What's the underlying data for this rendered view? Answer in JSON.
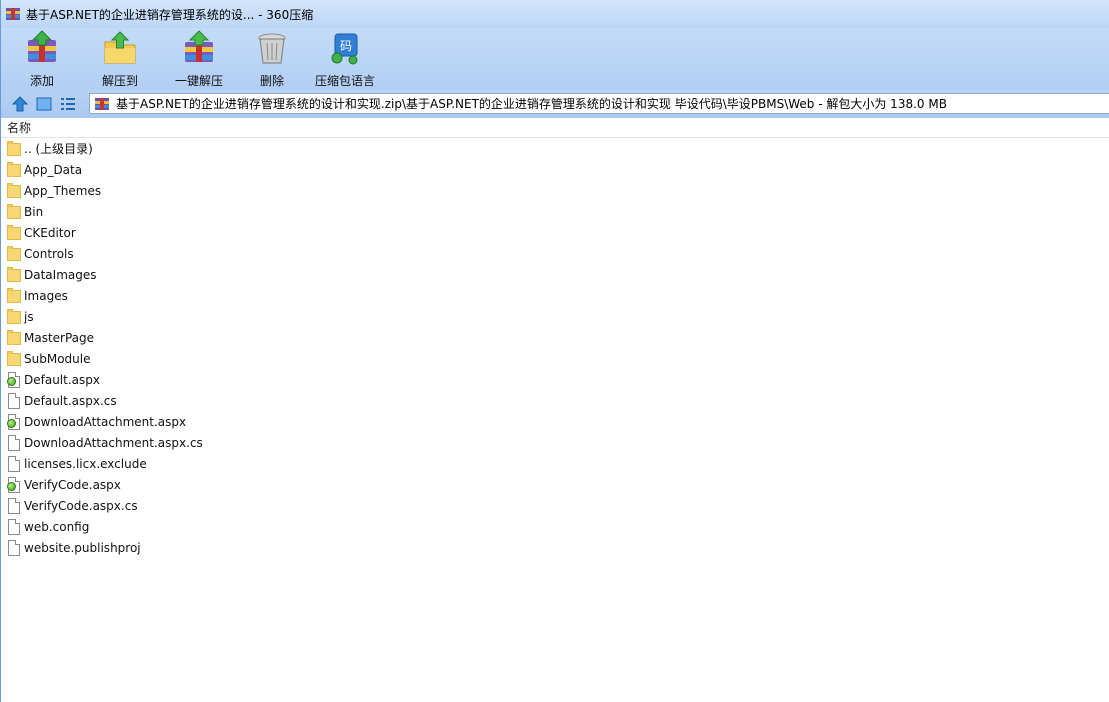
{
  "window": {
    "title": "基于ASP.NET的企业进销存管理系统的设... - 360压缩"
  },
  "toolbar": {
    "buttons": [
      {
        "label": "添加",
        "icon": "add-archive-icon"
      },
      {
        "label": "解压到",
        "icon": "extract-to-icon"
      },
      {
        "label": "一键解压",
        "icon": "one-click-extract-icon"
      },
      {
        "label": "删除",
        "icon": "delete-icon"
      },
      {
        "label": "压缩包语言",
        "icon": "archive-language-icon"
      }
    ]
  },
  "address": {
    "path": "基于ASP.NET的企业进销存管理系统的设计和实现.zip\\基于ASP.NET的企业进销存管理系统的设计和实现 毕设代码\\毕设PBMS\\Web - 解包大小为 138.0 MB"
  },
  "list": {
    "column_name": "名称",
    "items": [
      {
        "name": ".. (上级目录)",
        "type": "folder"
      },
      {
        "name": "App_Data",
        "type": "folder"
      },
      {
        "name": "App_Themes",
        "type": "folder"
      },
      {
        "name": "Bin",
        "type": "folder"
      },
      {
        "name": "CKEditor",
        "type": "folder"
      },
      {
        "name": "Controls",
        "type": "folder"
      },
      {
        "name": "DataImages",
        "type": "folder"
      },
      {
        "name": "Images",
        "type": "folder"
      },
      {
        "name": "js",
        "type": "folder"
      },
      {
        "name": "MasterPage",
        "type": "folder"
      },
      {
        "name": "SubModule",
        "type": "folder"
      },
      {
        "name": "Default.aspx",
        "type": "aspx"
      },
      {
        "name": "Default.aspx.cs",
        "type": "file"
      },
      {
        "name": "DownloadAttachment.aspx",
        "type": "aspx"
      },
      {
        "name": "DownloadAttachment.aspx.cs",
        "type": "file"
      },
      {
        "name": "licenses.licx.exclude",
        "type": "file"
      },
      {
        "name": "VerifyCode.aspx",
        "type": "aspx"
      },
      {
        "name": "VerifyCode.aspx.cs",
        "type": "file"
      },
      {
        "name": "web.config",
        "type": "file"
      },
      {
        "name": "website.publishproj",
        "type": "file"
      }
    ]
  }
}
